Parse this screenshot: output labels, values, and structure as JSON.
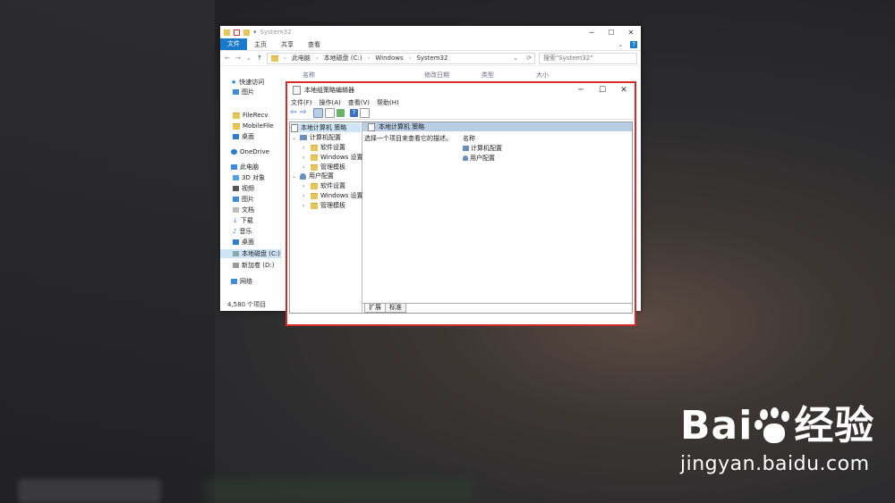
{
  "colors": {
    "accent": "#1979ca",
    "highlight": "#d42a2a",
    "selection": "#cde5f7",
    "header": "#b8cce4",
    "folder": "#e8c55a"
  },
  "explorer": {
    "title": "System32",
    "ribbon": [
      "文件",
      "主页",
      "共享",
      "查看"
    ],
    "path": [
      "此电脑",
      "本地磁盘 (C:)",
      "Windows",
      "System32"
    ],
    "search_placeholder": "搜索\"System32\"",
    "columns": [
      "名称",
      "修改日期",
      "类型",
      "大小"
    ],
    "nav": [
      {
        "label": "快速访问",
        "icon": "star-icon"
      },
      {
        "label": "图片",
        "icon": "pictures-icon"
      },
      {
        "label": "FileRecv",
        "icon": "folder-icon"
      },
      {
        "label": "MobileFile",
        "icon": "folder-icon"
      },
      {
        "label": "桌面",
        "icon": "desktop-icon"
      },
      {
        "label": "OneDrive",
        "icon": "cloud-icon"
      },
      {
        "label": "此电脑",
        "icon": "computer-icon"
      },
      {
        "label": "3D 对象",
        "icon": "cube-icon"
      },
      {
        "label": "视频",
        "icon": "video-icon"
      },
      {
        "label": "图片",
        "icon": "pictures-icon"
      },
      {
        "label": "文档",
        "icon": "document-icon"
      },
      {
        "label": "下载",
        "icon": "download-icon"
      },
      {
        "label": "音乐",
        "icon": "music-icon"
      },
      {
        "label": "桌面",
        "icon": "desktop-icon"
      },
      {
        "label": "本地磁盘 (C:)",
        "icon": "drive-icon"
      },
      {
        "label": "新加卷 (D:)",
        "icon": "drive-icon"
      },
      {
        "label": "网络",
        "icon": "network-icon"
      }
    ],
    "status": "4,580 个项目"
  },
  "gpedit": {
    "title": "本地组策略编辑器",
    "menu": [
      "文件(F)",
      "操作(A)",
      "查看(V)",
      "帮助(H)"
    ],
    "tree": {
      "root": "本地计算机 策略",
      "computer": "计算机配置",
      "user": "用户配置",
      "children": [
        "软件设置",
        "Windows 设置",
        "管理模板"
      ]
    },
    "right_header": "本地计算机 策略",
    "description": "选择一个项目来查看它的描述。",
    "list_header": "名称",
    "list_items": [
      "计算机配置",
      "用户配置"
    ],
    "tabs": [
      "扩展",
      "标准"
    ]
  },
  "watermark": {
    "logo_left": "Bai",
    "logo_right": "经验",
    "url": "jingyan.baidu.com"
  }
}
